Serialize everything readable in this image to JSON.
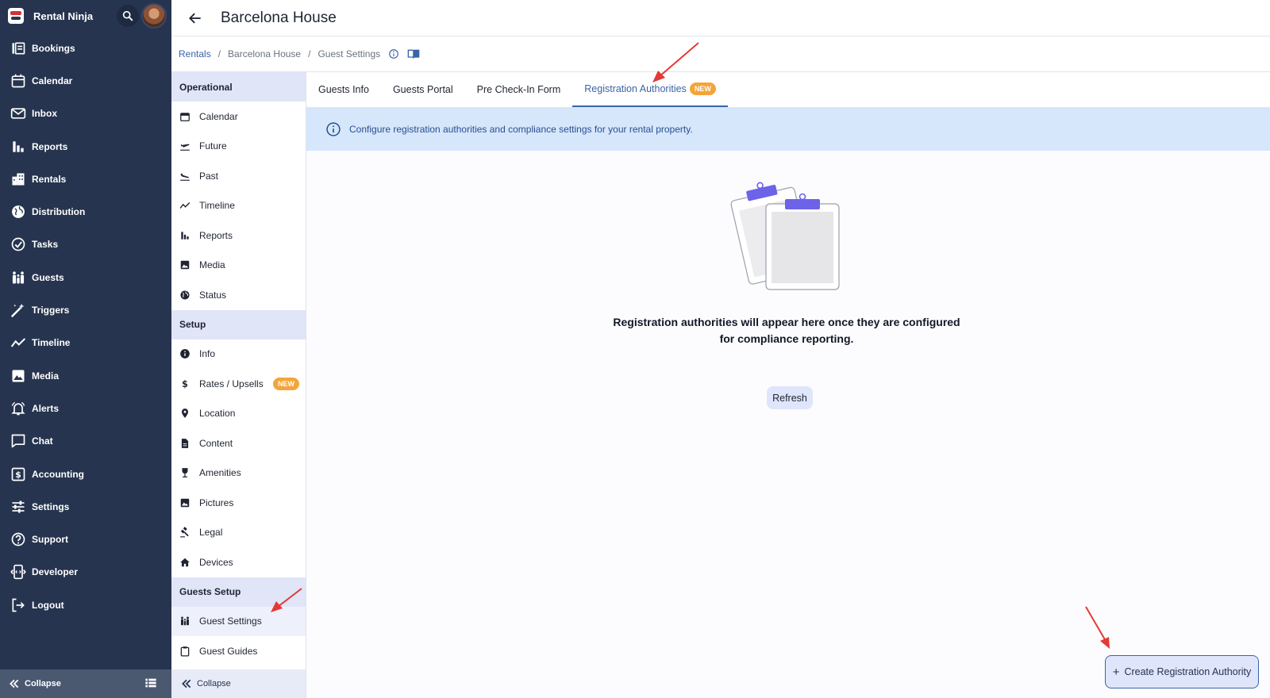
{
  "app": {
    "name": "Rental Ninja"
  },
  "nav": [
    {
      "label": "Bookings",
      "icon": "bookings-icon"
    },
    {
      "label": "Calendar",
      "icon": "calendar-icon"
    },
    {
      "label": "Inbox",
      "icon": "inbox-icon"
    },
    {
      "label": "Reports",
      "icon": "reports-icon"
    },
    {
      "label": "Rentals",
      "icon": "rentals-icon"
    },
    {
      "label": "Distribution",
      "icon": "globe-icon"
    },
    {
      "label": "Tasks",
      "icon": "check-circle-icon"
    },
    {
      "label": "Guests",
      "icon": "guests-icon"
    },
    {
      "label": "Triggers",
      "icon": "wand-icon"
    },
    {
      "label": "Timeline",
      "icon": "timeline-icon"
    },
    {
      "label": "Media",
      "icon": "image-icon"
    },
    {
      "label": "Alerts",
      "icon": "bell-icon"
    },
    {
      "label": "Chat",
      "icon": "chat-icon"
    },
    {
      "label": "Accounting",
      "icon": "dollar-icon"
    },
    {
      "label": "Settings",
      "icon": "sliders-icon"
    },
    {
      "label": "Support",
      "icon": "help-icon"
    },
    {
      "label": "Developer",
      "icon": "developer-icon"
    },
    {
      "label": "Logout",
      "icon": "logout-icon"
    }
  ],
  "app_collapse_label": "Collapse",
  "header": {
    "title": "Barcelona House"
  },
  "breadcrumb": {
    "root": "Rentals",
    "rental": "Barcelona House",
    "current": "Guest Settings"
  },
  "submenu": {
    "sections": [
      {
        "title": "Operational",
        "items": [
          {
            "label": "Calendar",
            "icon": "calendar-icon"
          },
          {
            "label": "Future",
            "icon": "plane-depart-icon"
          },
          {
            "label": "Past",
            "icon": "plane-land-icon"
          },
          {
            "label": "Timeline",
            "icon": "timeline-icon"
          },
          {
            "label": "Reports",
            "icon": "reports-icon"
          },
          {
            "label": "Media",
            "icon": "image-icon"
          },
          {
            "label": "Status",
            "icon": "globe-icon"
          }
        ]
      },
      {
        "title": "Setup",
        "items": [
          {
            "label": "Info",
            "icon": "info-icon"
          },
          {
            "label": "Rates / Upsells",
            "icon": "dollar-sign-icon",
            "badge": "NEW"
          },
          {
            "label": "Location",
            "icon": "pin-icon"
          },
          {
            "label": "Content",
            "icon": "document-icon"
          },
          {
            "label": "Amenities",
            "icon": "wine-icon"
          },
          {
            "label": "Pictures",
            "icon": "image-icon"
          },
          {
            "label": "Legal",
            "icon": "gavel-icon"
          },
          {
            "label": "Devices",
            "icon": "home-icon"
          }
        ]
      },
      {
        "title": "Guests Setup",
        "items": [
          {
            "label": "Guest Settings",
            "icon": "guests-icon",
            "active": true
          },
          {
            "label": "Guest Guides",
            "icon": "clipboard-icon"
          }
        ]
      }
    ],
    "collapse_label": "Collapse"
  },
  "tabs": [
    {
      "label": "Guests Info"
    },
    {
      "label": "Guests Portal"
    },
    {
      "label": "Pre Check-In Form"
    },
    {
      "label": "Registration Authorities",
      "badge": "NEW",
      "active": true
    }
  ],
  "banner": {
    "text": "Configure registration authorities and compliance settings for your rental property."
  },
  "empty_state": {
    "line1": "Registration authorities will appear here once they are configured",
    "line2": "for compliance reporting.",
    "refresh_label": "Refresh"
  },
  "create_button": {
    "label": "Create Registration Authority"
  },
  "colors": {
    "sidebar": "#26344f",
    "accent": "#3a64a8",
    "badge": "#f3a53a",
    "banner": "#d6e6fb",
    "annotation": "#e53935"
  }
}
